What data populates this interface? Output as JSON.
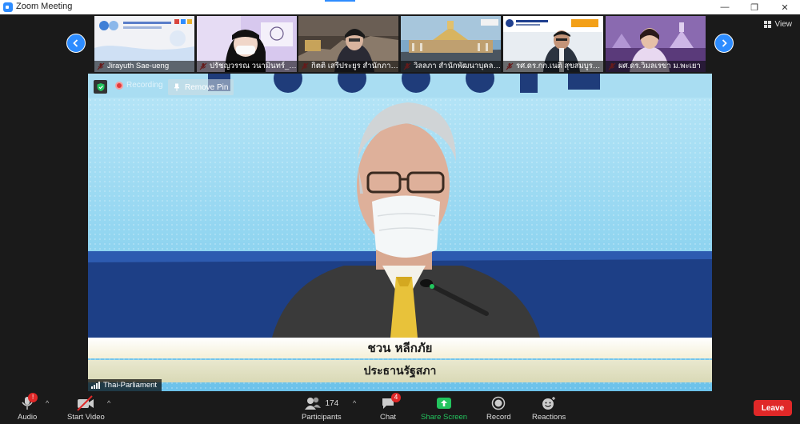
{
  "window": {
    "title": "Zoom Meeting",
    "controls": {
      "minimize": "—",
      "restore": "❐",
      "close": "✕"
    }
  },
  "thumbnails": [
    {
      "name": "Jirayuth Sae-ueng",
      "muted": true
    },
    {
      "name": "ปรัชญวรรณ วนามินทร์_สป.",
      "muted": true
    },
    {
      "name": "กิตติ เสรีประยูร สำนักภาษา...",
      "muted": true
    },
    {
      "name": "วิลลภา สำนักพัฒนาบุคลา...",
      "muted": true
    },
    {
      "name": "รศ.ดร.กก.เนติ สุขสมบูรณ์...",
      "muted": true
    },
    {
      "name": "ผศ.ดร.วิมลเรขา ม.พะเยา",
      "muted": true
    }
  ],
  "view_button": {
    "label": "View"
  },
  "main_video": {
    "recording_label": "Recording",
    "remove_pin_label": "Remove Pin",
    "caption_name": "ชวน หลีกภัย",
    "caption_title": "ประธานรัฐสภา",
    "speaker_label": "Thai-Parliament"
  },
  "toolbar": {
    "audio": {
      "label": "Audio",
      "alert": "!"
    },
    "video": {
      "label": "Start Video"
    },
    "participants": {
      "label": "Participants",
      "count": "174"
    },
    "chat": {
      "label": "Chat",
      "badge": "4"
    },
    "share": {
      "label": "Share Screen"
    },
    "record": {
      "label": "Record"
    },
    "reactions": {
      "label": "Reactions"
    },
    "leave": {
      "label": "Leave"
    }
  },
  "colors": {
    "accent": "#2d8cff",
    "share": "#23c45e",
    "leave": "#e02828",
    "toolbar_bg": "#1a1a1a"
  }
}
